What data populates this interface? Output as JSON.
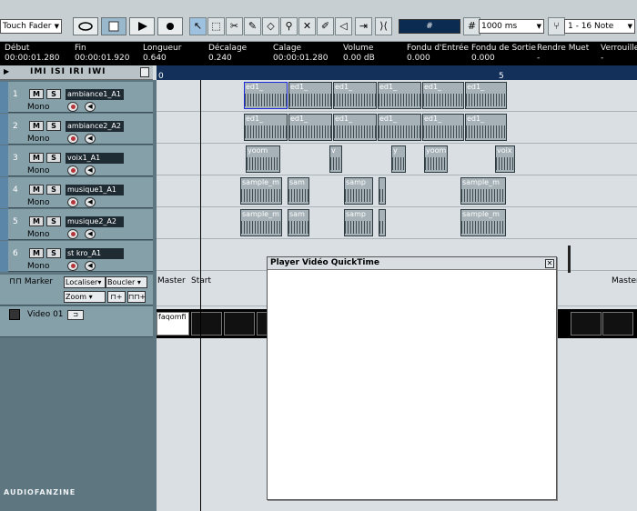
{
  "toolbar": {
    "fader_mode": "Touch Fader",
    "grid_symbol": "#",
    "quantize_value": "1000 ms",
    "note_value": "1 - 16 Note"
  },
  "info_line": {
    "headers": [
      "Début",
      "Fin",
      "Longueur",
      "Décalage",
      "Calage",
      "Volume",
      "Fondu d'Entrée",
      "Fondu de Sortie",
      "Rendre Muet",
      "Verrouille"
    ],
    "values": [
      "00:00:01.280",
      "00:00:01.920",
      "0.640",
      "0.240",
      "00:00:01.280",
      "0.00 dB",
      "0.000",
      "0.000",
      "-",
      "-"
    ]
  },
  "track_header": {
    "modes": "IMI ISI IRI IWI"
  },
  "ruler": {
    "marks": [
      "0",
      "5"
    ]
  },
  "tracks": [
    {
      "index": "1",
      "name": "ambiance1_A1",
      "mode": "Mono"
    },
    {
      "index": "2",
      "name": "ambiance2_A2",
      "mode": "Mono"
    },
    {
      "index": "3",
      "name": "voix1_A1",
      "mode": "Mono"
    },
    {
      "index": "4",
      "name": "musique1_A1",
      "mode": "Mono"
    },
    {
      "index": "5",
      "name": "musique2_A2",
      "mode": "Mono"
    },
    {
      "index": "6",
      "name": "st kro_A1",
      "mode": "Mono"
    }
  ],
  "marker_track": {
    "label": "Marker",
    "locate": "Localiser",
    "loop": "Boucler",
    "zoom": "Zoom"
  },
  "video_track": {
    "label": "Video 01"
  },
  "arrange": {
    "lane1": [
      "ed1_",
      "ed1_",
      "ed1_",
      "ed1_",
      "ed1_",
      "ed1_"
    ],
    "lane2": [
      "ed1_",
      "ed1_",
      "ed1_",
      "ed1_",
      "ed1_",
      "ed1_"
    ],
    "lane3": [
      "yoom",
      "v",
      "y",
      "yoom",
      "voix"
    ],
    "lane4": [
      "sample_m",
      "sam",
      "samp",
      "sample_m"
    ],
    "lane5": [
      "sample_m",
      "sam",
      "samp",
      "sample_m"
    ],
    "markers": [
      "Master",
      "Start",
      "Master"
    ],
    "video_clip": "faqomfi"
  },
  "player": {
    "title": "Player Vidéo QuickTime"
  },
  "watermark": "AUDIOFANZINE"
}
